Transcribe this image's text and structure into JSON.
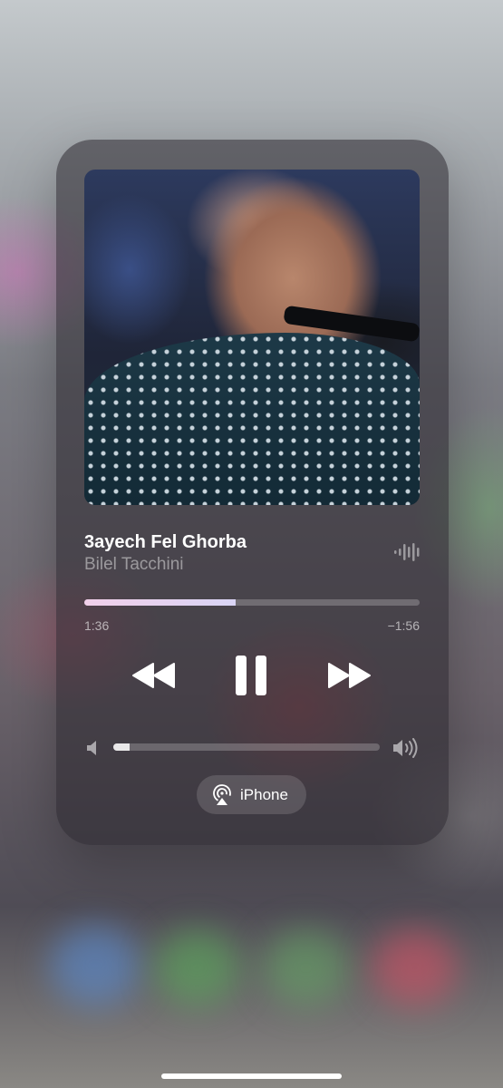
{
  "now_playing": {
    "title": "3ayech Fel Ghorba",
    "artist": "Bilel Tacchini",
    "progress_fraction": 0.45,
    "elapsed": "1:36",
    "remaining": "−1:56",
    "volume_fraction": 0.06
  },
  "output": {
    "device_label": "iPhone"
  },
  "icons": {
    "waveform": "waveform-icon",
    "rewind": "rewind-icon",
    "pause": "pause-icon",
    "fast_forward": "fast-forward-icon",
    "volume_low": "speaker-low-icon",
    "volume_high": "speaker-high-icon",
    "airplay": "airplay-icon"
  },
  "colors": {
    "progress_start": "#f2d0ea",
    "progress_end": "#d9d4f5",
    "card_bg": "#28242c"
  }
}
